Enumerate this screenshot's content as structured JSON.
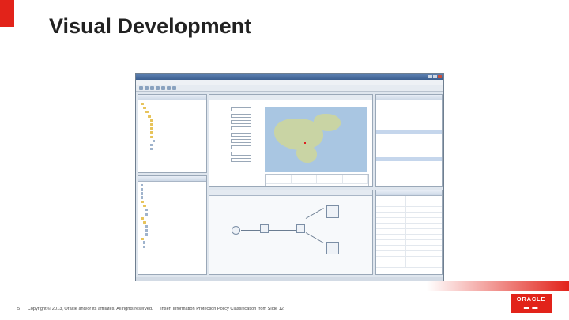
{
  "slide": {
    "title": "Visual Development",
    "footer": {
      "page_number": "5",
      "copyright": "Copyright © 2013, Oracle and/or its affiliates. All rights reserved.",
      "classification": "Insert Information Protection Policy Classification from Slide 12"
    },
    "logo_text": "ORACLE"
  },
  "colors": {
    "accent": "#e2231a",
    "ide_frame": "#6f7f90",
    "title_bar": "#3c5f90"
  }
}
